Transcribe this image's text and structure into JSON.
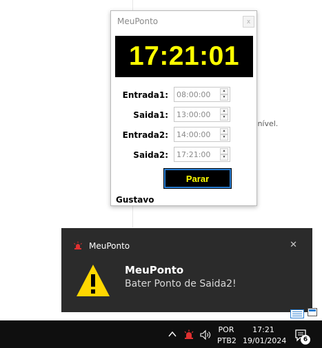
{
  "background": {
    "partial_text": "sponível."
  },
  "window": {
    "title": "MeuPonto",
    "close_glyph": "x",
    "clock": "17:21:01",
    "fields": [
      {
        "label": "Entrada1:",
        "value": "08:00:00"
      },
      {
        "label": "Saida1:",
        "value": "13:00:00"
      },
      {
        "label": "Entrada2:",
        "value": "14:00:00"
      },
      {
        "label": "Saida2:",
        "value": "17:21:00"
      }
    ],
    "stop_button": "Parar",
    "user": "Gustavo"
  },
  "toast": {
    "app_name": "MeuPonto",
    "close_glyph": "✕",
    "title": "MeuPonto",
    "message": "Bater Ponto de Saida2!",
    "icon": "warning-icon"
  },
  "taskbar": {
    "lang_top": "POR",
    "lang_bottom": "PTB2",
    "time": "17:21",
    "date": "19/01/2024",
    "notification_count": "6",
    "icons": [
      "chevron-up-icon",
      "alarm-icon",
      "volume-icon",
      "notification-icon"
    ]
  },
  "colors": {
    "clock_bg": "#000000",
    "clock_fg": "#ffff00",
    "button_border": "#2a7fd4",
    "toast_bg": "#2b2b2b",
    "warning_yellow": "#ffd700",
    "taskbar_bg": "#0f0f0f"
  }
}
